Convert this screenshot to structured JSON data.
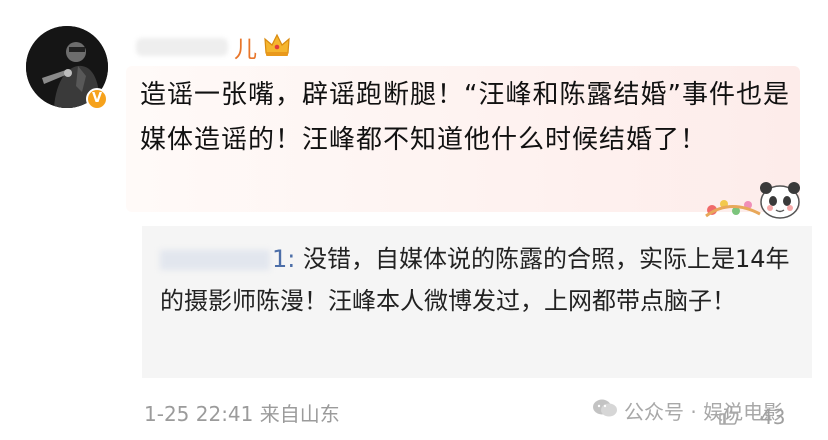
{
  "user": {
    "username": "儿",
    "avatar_icon": "singer-with-microphone",
    "badge_icon": "verified-v-icon",
    "badge_letter": "V",
    "crown_icon": "crown-icon"
  },
  "comment": {
    "text": "造谣一张嘴，辟谣跑断腿！“汪峰和陈露结婚”事件也是媒体造谣的！汪峰都不知道他什么时候结婚了！"
  },
  "reply": {
    "author_suffix": "1:",
    "text": " 没错，自媒体说的陈露的合照，实际上是14年的摄影师陈漫！汪峰本人微博发过，上网都带点脑子！"
  },
  "meta": {
    "timestamp": "1-25 22:41",
    "location": "来自山东"
  },
  "watermark": {
    "text": "公众号 · 娱说电影"
  },
  "actions": {
    "like_count": "43"
  }
}
